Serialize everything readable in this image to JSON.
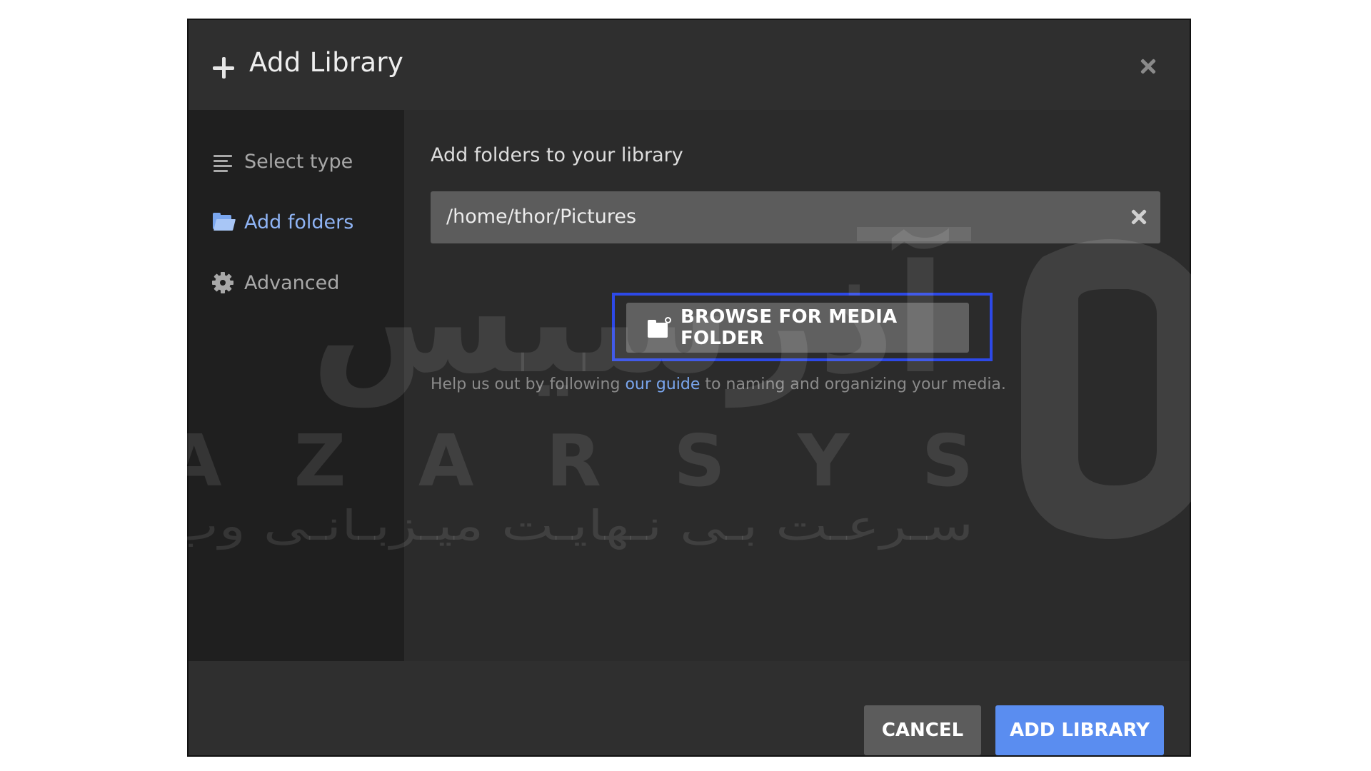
{
  "dialog": {
    "title": "Add Library",
    "header_icon": "plus-icon",
    "close_icon": "close-icon"
  },
  "sidebar": {
    "items": [
      {
        "label": "Select type",
        "icon": "lines-icon",
        "active": false
      },
      {
        "label": "Add folders",
        "icon": "folder-icon",
        "active": true
      },
      {
        "label": "Advanced",
        "icon": "gear-icon",
        "active": false
      }
    ]
  },
  "main": {
    "heading": "Add folders to your library",
    "folder_path": "/home/thor/Pictures",
    "browse_label": "BROWSE FOR MEDIA FOLDER",
    "help_prefix": "Help us out by following ",
    "help_link": "our guide",
    "help_suffix": " to naming and organizing your media."
  },
  "footer": {
    "cancel_label": "CANCEL",
    "add_label": "ADD LIBRARY"
  },
  "watermark": {
    "latin": "AZARSYS",
    "persian_tagline": "سـرعـت بـی نـهایـت میـزبـانـی وب",
    "persian_brand": "آذرسیس"
  },
  "colors": {
    "accent": "#5a8df0",
    "focus_ring": "#2d49e8",
    "active_sidebar": "#8fb4f5",
    "dialog_bg": "#2b2b2b",
    "sidebar_bg": "#1f1f1f"
  }
}
